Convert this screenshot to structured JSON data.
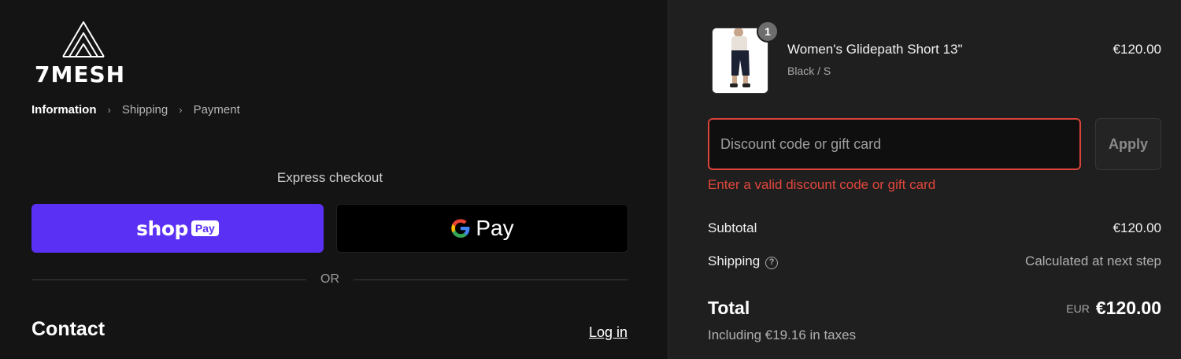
{
  "brand": {
    "name": "7MESH"
  },
  "breadcrumb": {
    "items": [
      {
        "label": "Information",
        "active": true
      },
      {
        "label": "Shipping",
        "active": false
      },
      {
        "label": "Payment",
        "active": false
      }
    ],
    "separator": "›"
  },
  "express_checkout": {
    "title": "Express checkout",
    "shop_pay": {
      "word": "shop",
      "chip": "Pay"
    },
    "google_pay": {
      "label": "Pay"
    },
    "divider": "OR"
  },
  "contact": {
    "title": "Contact",
    "login_label": "Log in"
  },
  "cart": {
    "item": {
      "quantity": "1",
      "name": "Women's Glidepath Short 13\"",
      "variant": "Black / S",
      "price": "€120.00"
    }
  },
  "discount": {
    "placeholder": "Discount code or gift card",
    "value": "",
    "apply_label": "Apply",
    "error": "Enter a valid discount code or gift card"
  },
  "summary": {
    "subtotal_label": "Subtotal",
    "subtotal_value": "€120.00",
    "shipping_label": "Shipping",
    "shipping_value": "Calculated at next step",
    "help_icon": "?",
    "total_label": "Total",
    "currency": "EUR",
    "total_value": "€120.00",
    "taxes_note": "Including €19.16 in taxes"
  },
  "colors": {
    "shop_pay_purple": "#5a31f4",
    "error_red": "#e2473c",
    "left_bg": "#141414",
    "right_bg": "#1f1f1f"
  }
}
